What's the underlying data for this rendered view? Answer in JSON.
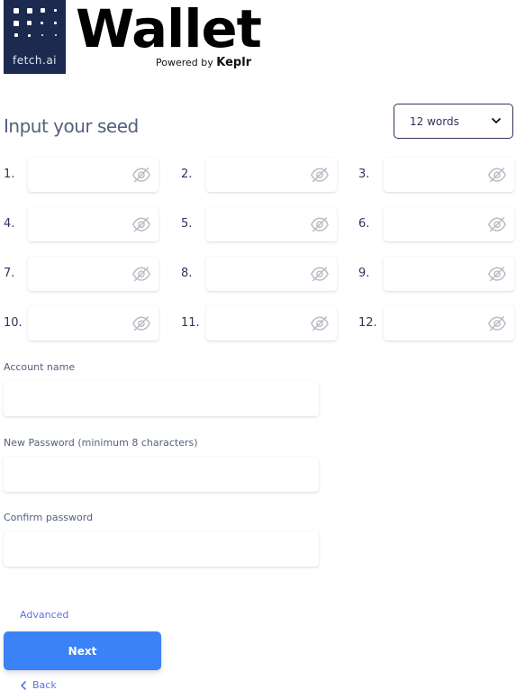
{
  "brand": {
    "logo_text": "fetch.ai",
    "app_name": "Wallet",
    "powered_prefix": "Powered by",
    "powered_brand": "Keplr"
  },
  "seed": {
    "title": "Input your seed",
    "word_count": {
      "selected": "12 words"
    },
    "fields": [
      {
        "label": "1.",
        "value": ""
      },
      {
        "label": "2.",
        "value": ""
      },
      {
        "label": "3.",
        "value": ""
      },
      {
        "label": "4.",
        "value": ""
      },
      {
        "label": "5.",
        "value": ""
      },
      {
        "label": "6.",
        "value": ""
      },
      {
        "label": "7.",
        "value": ""
      },
      {
        "label": "8.",
        "value": ""
      },
      {
        "label": "9.",
        "value": ""
      },
      {
        "label": "10.",
        "value": ""
      },
      {
        "label": "11.",
        "value": ""
      },
      {
        "label": "12.",
        "value": ""
      }
    ]
  },
  "form": {
    "account_name": {
      "label": "Account name",
      "value": ""
    },
    "new_password": {
      "label": "New Password (minimum 8 characters)",
      "value": ""
    },
    "confirm_password": {
      "label": "Confirm password",
      "value": ""
    }
  },
  "actions": {
    "advanced": "Advanced",
    "next": "Next",
    "back": "Back"
  },
  "colors": {
    "logo_bg": "#1d2a4f",
    "primary_button": "#3b82f6",
    "link": "#5e72e4",
    "text": "#32325d"
  },
  "icons": {
    "seed_visibility": "eye-slash-icon",
    "select": "chevron-down-icon",
    "back": "chevron-left-icon"
  }
}
